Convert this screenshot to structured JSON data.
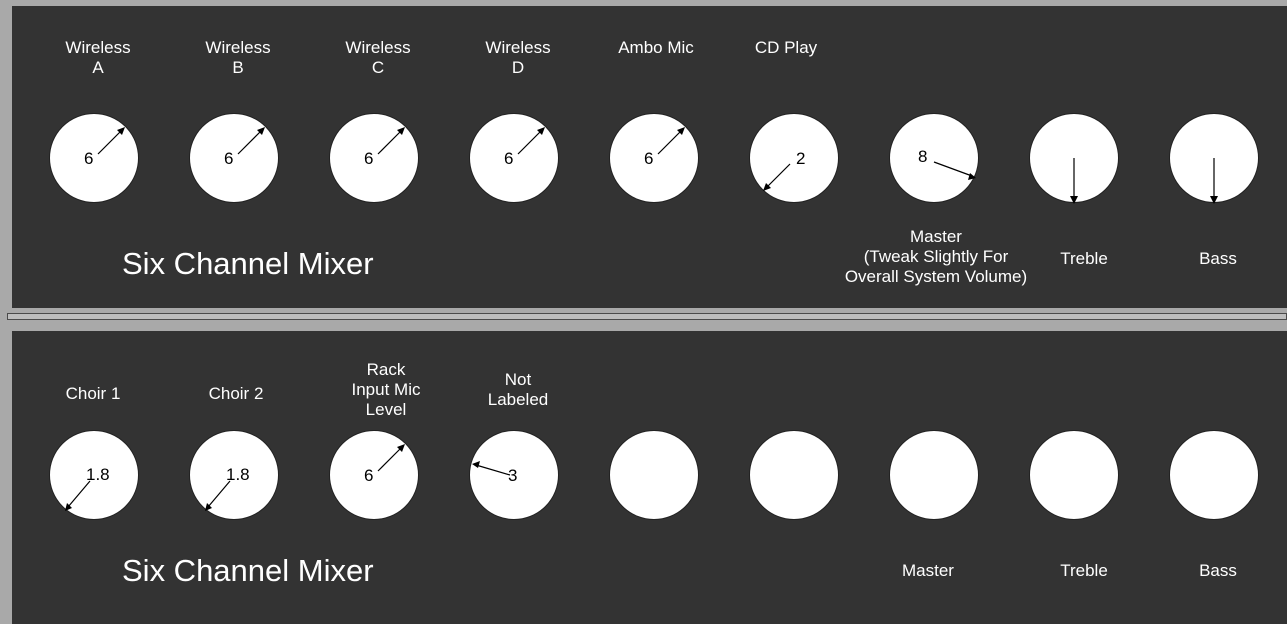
{
  "mixers": [
    {
      "title": "Six Channel Mixer",
      "channels": [
        {
          "label": "Wireless\nA",
          "value": "6"
        },
        {
          "label": "Wireless\nB",
          "value": "6"
        },
        {
          "label": "Wireless\nC",
          "value": "6"
        },
        {
          "label": "Wireless\nD",
          "value": "6"
        },
        {
          "label": "Ambo Mic",
          "value": "6"
        },
        {
          "label": "CD Play",
          "value": "2"
        },
        {
          "label": "",
          "value": "8"
        },
        {
          "label": "",
          "value": ""
        },
        {
          "label": "",
          "value": ""
        }
      ],
      "bottom_labels": [
        "Master\n(Tweak Slightly For\nOverall System Volume)",
        "Treble",
        "Bass"
      ]
    },
    {
      "title": "Six Channel Mixer",
      "channels": [
        {
          "label": "Choir 1",
          "value": "1.8"
        },
        {
          "label": "Choir 2",
          "value": "1.8"
        },
        {
          "label": "Rack\nInput Mic\nLevel",
          "value": "6"
        },
        {
          "label": "Not\nLabeled",
          "value": "3"
        },
        {
          "label": "",
          "value": ""
        },
        {
          "label": "",
          "value": ""
        },
        {
          "label": "",
          "value": ""
        },
        {
          "label": "",
          "value": ""
        },
        {
          "label": "",
          "value": ""
        }
      ],
      "bottom_labels": [
        "Master",
        "Treble",
        "Bass"
      ]
    }
  ]
}
